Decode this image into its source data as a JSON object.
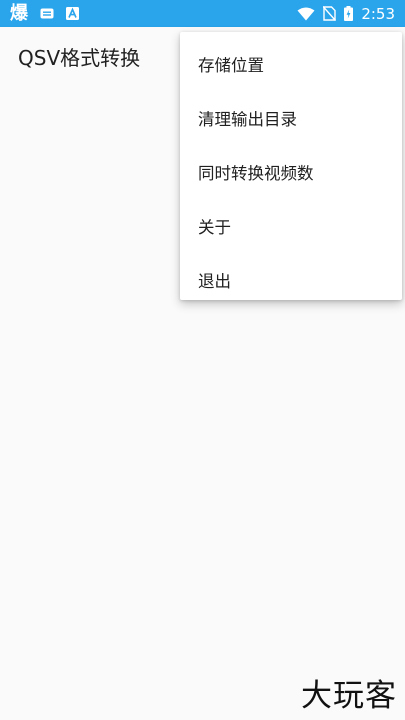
{
  "status_bar": {
    "notification_char": "爆",
    "time": "2:53",
    "icons_left": [
      "message-notification-icon",
      "a-box-notification-icon"
    ],
    "icons_right": [
      "wifi-icon",
      "no-sim-icon",
      "battery-charging-icon"
    ],
    "background": "#2aa5ec"
  },
  "app_bar": {
    "title": "QSV格式转换"
  },
  "menu": {
    "items": [
      {
        "label": "存储位置"
      },
      {
        "label": "清理输出目录"
      },
      {
        "label": "同时转换视频数"
      },
      {
        "label": "关于"
      },
      {
        "label": "退出"
      }
    ]
  },
  "watermark": {
    "text": "大玩客"
  }
}
